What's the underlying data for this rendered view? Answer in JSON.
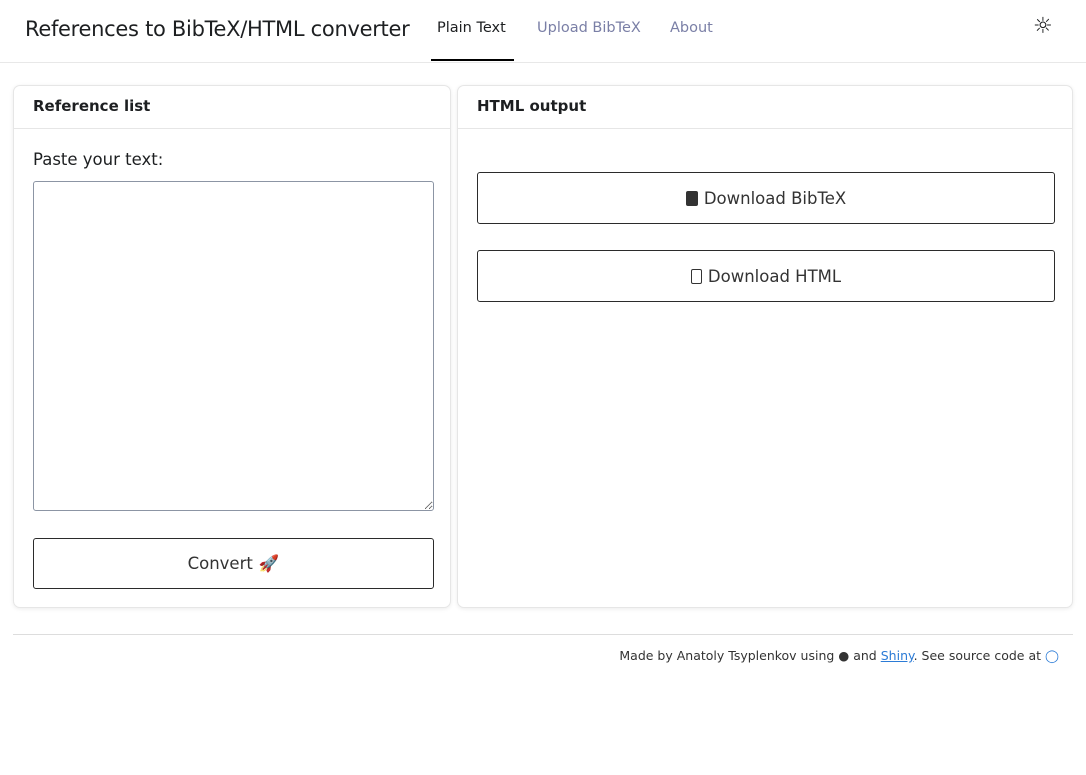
{
  "header": {
    "title": "References to BibTeX/HTML converter",
    "tabs": [
      {
        "label": "Plain Text"
      },
      {
        "label": "Upload BibTeX"
      },
      {
        "label": "About"
      }
    ],
    "theme_icon": "☼"
  },
  "left": {
    "title": "Reference list",
    "label": "Paste your text:",
    "textarea_value": "",
    "convert_label": "Convert",
    "convert_icon": "🚀"
  },
  "right": {
    "title": "HTML output",
    "download_bibtex": "Download BibTeX",
    "download_html": "Download HTML"
  },
  "footer": {
    "text1": "Made by Anatoly Tsyplenkov using",
    "text2": "and",
    "link": "Shiny",
    "text3": ". See source code at"
  }
}
